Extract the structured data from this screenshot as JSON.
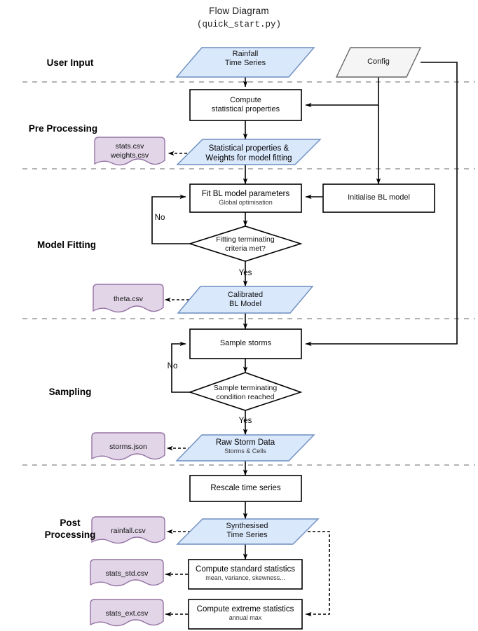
{
  "header": {
    "title": "Flow Diagram",
    "subtitle": "(quick_start.py)"
  },
  "stages": [
    {
      "id": "user-input",
      "label": "User Input"
    },
    {
      "id": "pre-processing",
      "label": "Pre Processing"
    },
    {
      "id": "model-fitting",
      "label": "Model Fitting"
    },
    {
      "id": "sampling",
      "label": "Sampling"
    },
    {
      "id": "post-processing",
      "label": "Post\nProcessing"
    }
  ],
  "nodes": {
    "rainfall_time_series": {
      "line1": "Rainfall",
      "line2": "Time Series"
    },
    "config": {
      "line1": "Config"
    },
    "compute_stats": {
      "line1": "Compute",
      "line2": "statistical properties"
    },
    "stats_weights_data": {
      "line1": "Statistical properties &",
      "line2": "Weights for model fitting"
    },
    "stats_weights_file": {
      "line1": "stats.csv",
      "line2": "weights.csv"
    },
    "fit_bl": {
      "line1": "Fit BL model parameters",
      "line2": "Global optimisation"
    },
    "init_bl": {
      "line1": "Initialise BL model"
    },
    "fit_decision": {
      "line1": "Fitting terminating",
      "line2": "criteria met?"
    },
    "theta_file": {
      "line1": "theta.csv"
    },
    "calibrated_model": {
      "line1": "Calibrated",
      "line2": "BL Model"
    },
    "sample_storms": {
      "line1": "Sample storms"
    },
    "sample_decision": {
      "line1": "Sample terminating",
      "line2": "condition reached"
    },
    "storms_file": {
      "line1": "storms.json"
    },
    "raw_storm_data": {
      "line1": "Raw Storm Data",
      "line2": "Storms & Cells"
    },
    "rescale": {
      "line1": "Rescale time series"
    },
    "rainfall_file": {
      "line1": "rainfall.csv"
    },
    "synth_time_series": {
      "line1": "Synthesised",
      "line2": "Time Series"
    },
    "stats_std_file": {
      "line1": "stats_std.csv"
    },
    "compute_standard": {
      "line1": "Compute standard statistics",
      "line2": "mean, variance, skewness..."
    },
    "stats_ext_file": {
      "line1": "stats_ext.csv"
    },
    "compute_extreme": {
      "line1": "Compute extreme statistics",
      "line2": "annual max"
    }
  },
  "edge_labels": {
    "fit_no": "No",
    "fit_yes": "Yes",
    "sample_no": "No",
    "sample_yes": "Yes"
  },
  "colors": {
    "data_fill": "#dae8fc",
    "data_stroke": "#6c8ebf",
    "config_fill": "#f5f5f5",
    "config_stroke": "#666666",
    "file_fill": "#e1d5e7",
    "file_stroke": "#9673a6",
    "process_fill": "#ffffff",
    "process_stroke": "#000000",
    "separator": "#b3b3b3",
    "edge": "#000000"
  }
}
